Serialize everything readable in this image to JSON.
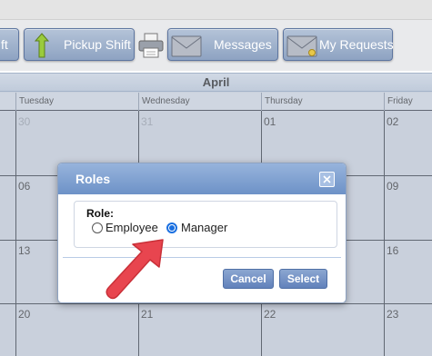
{
  "toolbar": {
    "buttons": [
      {
        "label": "ft",
        "icon": "shift-icon"
      },
      {
        "label": "Pickup Shift",
        "icon": "up-arrow-icon"
      },
      {
        "label": "",
        "icon": "printer-icon"
      },
      {
        "label": "Messages",
        "icon": "envelope-icon"
      },
      {
        "label": "My Requests",
        "icon": "requests-icon"
      }
    ]
  },
  "calendar": {
    "month": "April",
    "days": [
      "Tuesday",
      "Wednesday",
      "Thursday",
      "Friday"
    ],
    "dates": {
      "row1": [
        "30",
        "31",
        "01",
        "02"
      ],
      "row2": [
        "06",
        "09"
      ],
      "row3": [
        "13",
        "16"
      ],
      "row4": [
        "20",
        "21",
        "22",
        "23"
      ]
    }
  },
  "dialog": {
    "title": "Roles",
    "role_label": "Role:",
    "options": [
      "Employee",
      "Manager"
    ],
    "selected": "Manager",
    "cancel_label": "Cancel",
    "select_label": "Select"
  },
  "colors": {
    "accent": "#6d92c7",
    "annotation_arrow": "#e8454f"
  }
}
